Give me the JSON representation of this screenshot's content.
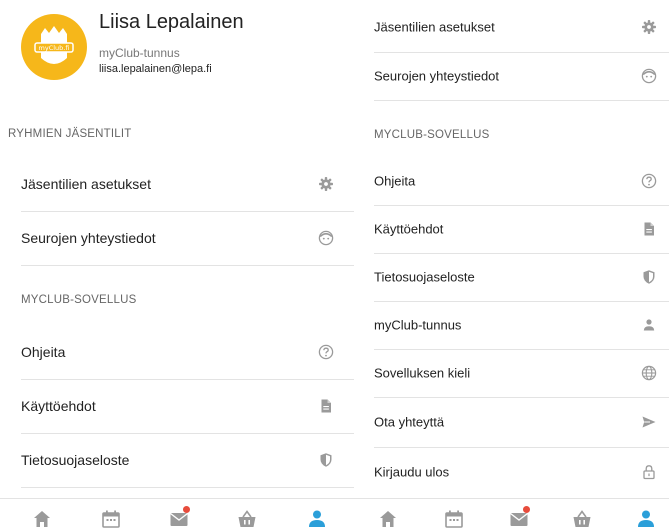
{
  "profile": {
    "name": "Liisa Lepalainen",
    "account_type": "myClub-tunnus",
    "email": "liisa.lepalainen@lepa.fi",
    "logo_text": "myClub.fi"
  },
  "left_screen": {
    "sections": [
      {
        "title": "RYHMIEN JÄSENTILIT"
      },
      {
        "title": "MYCLUB-SOVELLUS"
      }
    ],
    "items": [
      {
        "label": "Jäsentilien asetukset",
        "icon": "gear-icon"
      },
      {
        "label": "Seurojen yhteystiedot",
        "icon": "face-icon"
      },
      {
        "label": "Ohjeita",
        "icon": "help-icon"
      },
      {
        "label": "Käyttöehdot",
        "icon": "document-icon"
      },
      {
        "label": "Tietosuojaseloste",
        "icon": "shield-icon"
      }
    ]
  },
  "right_screen": {
    "sections": [
      {
        "title": "MYCLUB-SOVELLUS"
      }
    ],
    "items": [
      {
        "label": "Jäsentilien asetukset",
        "icon": "gear-icon"
      },
      {
        "label": "Seurojen yhteystiedot",
        "icon": "face-icon"
      },
      {
        "label": "Ohjeita",
        "icon": "help-icon"
      },
      {
        "label": "Käyttöehdot",
        "icon": "document-icon"
      },
      {
        "label": "Tietosuojaseloste",
        "icon": "shield-icon"
      },
      {
        "label": "myClub-tunnus",
        "icon": "person-icon"
      },
      {
        "label": "Sovelluksen kieli",
        "icon": "globe-icon"
      },
      {
        "label": "Ota yhteyttä",
        "icon": "send-icon"
      },
      {
        "label": "Kirjaudu ulos",
        "icon": "lock-icon"
      }
    ]
  },
  "bottom_nav": {
    "items": [
      {
        "icon": "home-icon",
        "active": false,
        "badge": false
      },
      {
        "icon": "calendar-icon",
        "active": false,
        "badge": false
      },
      {
        "icon": "mail-icon",
        "active": false,
        "badge": true
      },
      {
        "icon": "shop-basket-icon",
        "active": false,
        "badge": false
      },
      {
        "icon": "profile-icon",
        "active": true,
        "badge": false
      }
    ]
  },
  "colors": {
    "accent": "#2b9fd9",
    "icon_gray": "#9a9a9a",
    "logo_yellow": "#f6b71a",
    "badge_red": "#e74c3c",
    "divider": "#e3e3e3"
  }
}
